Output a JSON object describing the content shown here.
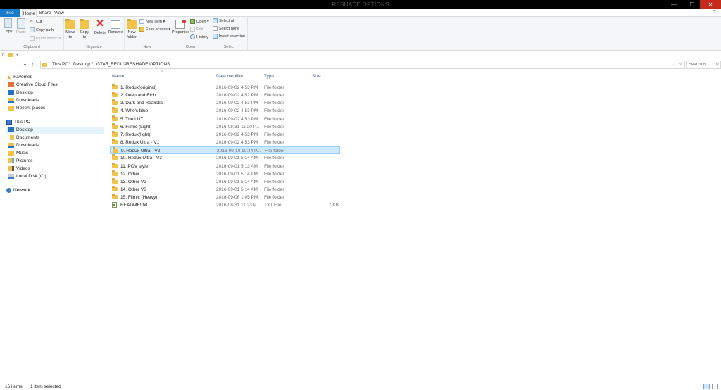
{
  "window": {
    "title": "RESHADE OPTIONS",
    "minimize_glyph": "—",
    "maximize_glyph": "☐",
    "close_glyph": "✕"
  },
  "tabs": [
    {
      "label": "File"
    },
    {
      "label": "Home"
    },
    {
      "label": "Share"
    },
    {
      "label": "View"
    }
  ],
  "help_glyph": "?",
  "ribbon": {
    "clipboard": {
      "label": "Clipboard",
      "copy": "Copy",
      "paste": "Paste",
      "cut": "Cut",
      "copy_path": "Copy path",
      "paste_shortcut": "Paste shortcut"
    },
    "organize": {
      "label": "Organize",
      "move_to": "Move to",
      "copy_to": "Copy to",
      "delete": "Delete",
      "rename": "Rename"
    },
    "new": {
      "label": "New",
      "new_folder": "New folder",
      "new_item": "New item",
      "easy_access": "Easy access"
    },
    "open": {
      "label": "Open",
      "properties": "Properties",
      "open": "Open",
      "edit": "Edit",
      "history": "History"
    },
    "select": {
      "label": "Select",
      "select_all": "Select all",
      "select_none": "Select none",
      "invert_selection": "Invert selection"
    }
  },
  "address": {
    "crumbs": [
      "This PC",
      "Desktop",
      "GTA5_REDUX",
      "RESHADE OPTIONS"
    ],
    "search_placeholder": "Search R..."
  },
  "nav_pane": {
    "favorites_header": "Favorites",
    "favorites": [
      "Creative Cloud Files",
      "Desktop",
      "Downloads",
      "Recent places"
    ],
    "thispc_header": "This PC",
    "thispc": [
      "Desktop",
      "Documents",
      "Downloads",
      "Music",
      "Pictures",
      "Videos",
      "Local Disk (C:)"
    ],
    "network": "Network"
  },
  "columns": {
    "name": "Name",
    "date": "Date modified",
    "type": "Type",
    "size": "Size"
  },
  "files": [
    {
      "name": "1. Redux(original)",
      "date": "2016-09-02 4:53 PM",
      "type": "File folder",
      "size": ""
    },
    {
      "name": "2. Deep and Rich",
      "date": "2016-09-02 4:52 PM",
      "type": "File folder",
      "size": ""
    },
    {
      "name": "3. Dark and Realistic",
      "date": "2016-09-02 4:53 PM",
      "type": "File folder",
      "size": ""
    },
    {
      "name": "4. Who's blue",
      "date": "2016-09-02 4:53 PM",
      "type": "File folder",
      "size": ""
    },
    {
      "name": "5. The LUT",
      "date": "2016-09-02 4:53 PM",
      "type": "File folder",
      "size": ""
    },
    {
      "name": "6. Filmic (Light)",
      "date": "2016-08-31 11:20 P...",
      "type": "File folder",
      "size": ""
    },
    {
      "name": "7. Redux(light)",
      "date": "2016-09-02 4:53 PM",
      "type": "File folder",
      "size": ""
    },
    {
      "name": "8. Redux Ultra - V1",
      "date": "2016-09-02 4:53 PM",
      "type": "File folder",
      "size": ""
    },
    {
      "name": "9. Redux Ultra - V2",
      "date": "2016-09-10 10:44 P...",
      "type": "File folder",
      "size": ""
    },
    {
      "name": "10. Redux Ultra - V3",
      "date": "2016-09-01 5:14 AM",
      "type": "File folder",
      "size": ""
    },
    {
      "name": "11. POV style",
      "date": "2016-09-01 5:13 AM",
      "type": "File folder",
      "size": ""
    },
    {
      "name": "12. Other",
      "date": "2016-09-01 5:14 AM",
      "type": "File folder",
      "size": ""
    },
    {
      "name": "13. Other V2",
      "date": "2016-09-01 5:14 AM",
      "type": "File folder",
      "size": ""
    },
    {
      "name": "14. Other V3",
      "date": "2016-09-01 5:14 AM",
      "type": "File folder",
      "size": ""
    },
    {
      "name": "15. Filmic (Heavy)",
      "date": "2016-09-06 1:05 PM",
      "type": "File folder",
      "size": ""
    },
    {
      "name": "README!.txt",
      "date": "2016-08-31 11:23 P...",
      "type": "TXT File",
      "size": "7 KB"
    }
  ],
  "status": {
    "items": "16 items",
    "selected": "1 item selected"
  },
  "colors": {
    "accent": "#1979ca",
    "selection": "#cce8ff",
    "folder": "#f0c44c"
  }
}
